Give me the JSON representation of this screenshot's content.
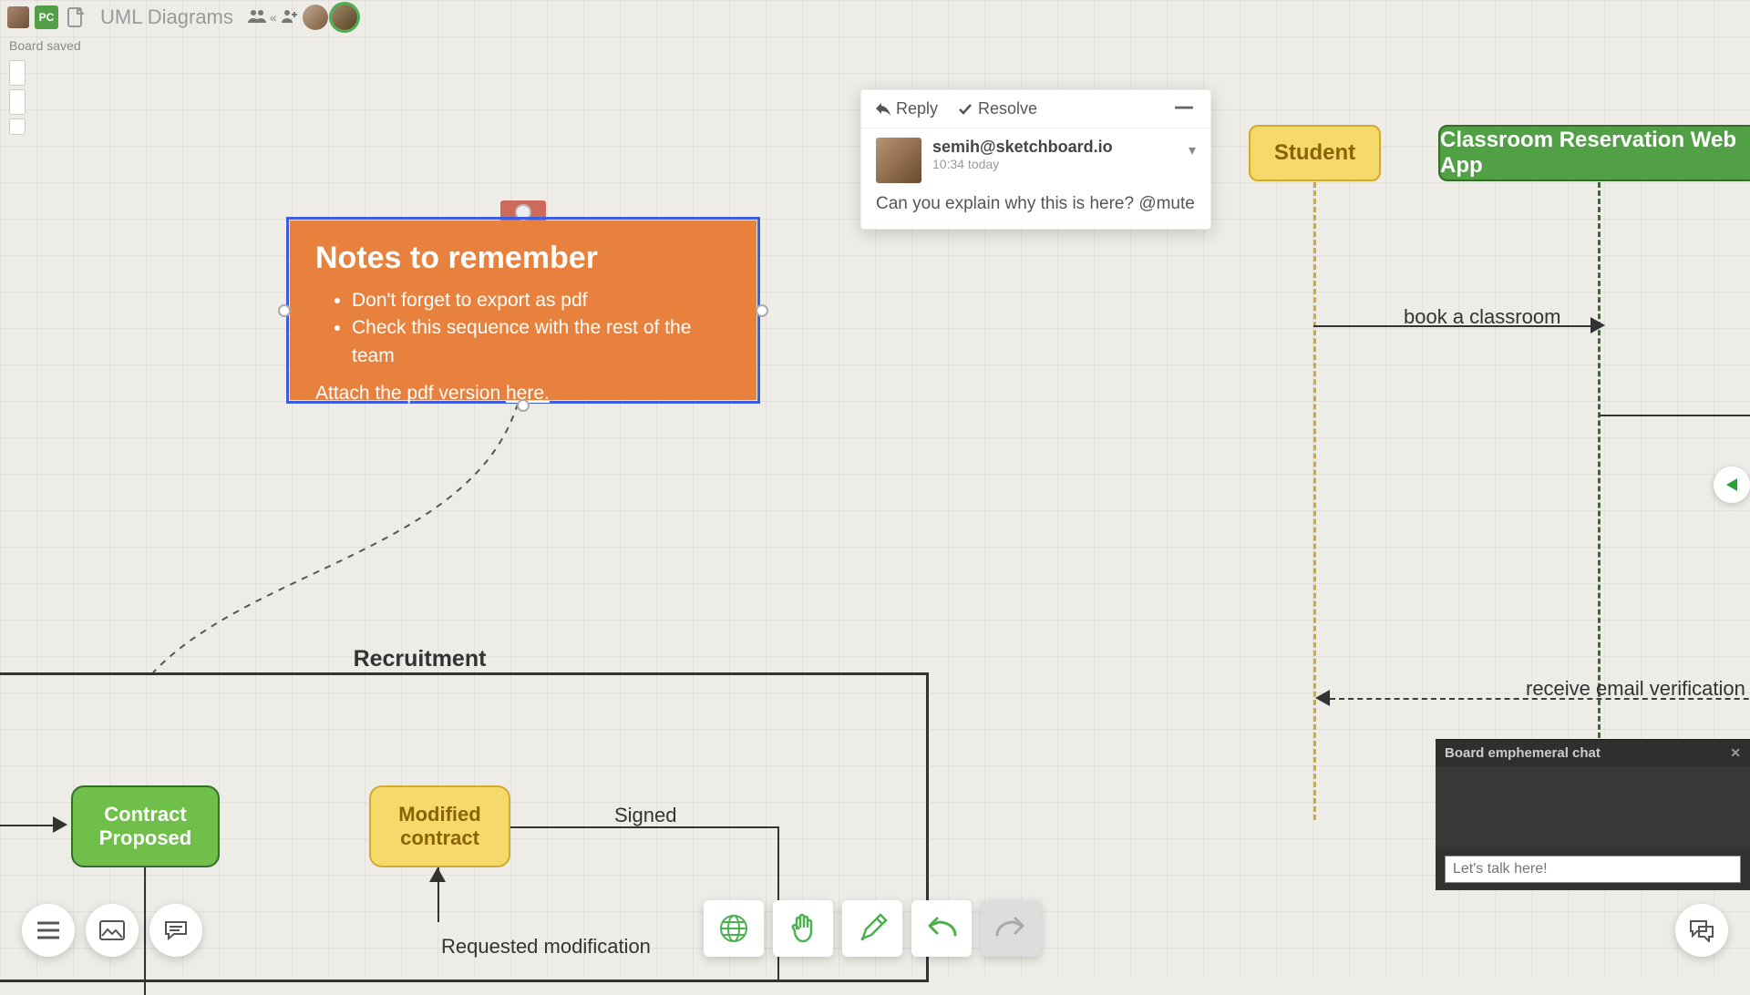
{
  "header": {
    "title": "UML Diagrams",
    "initials": "PC",
    "save_status": "Board saved"
  },
  "note": {
    "title": "Notes to remember",
    "bullets": [
      "Don't forget to export as pdf",
      "Check this sequence with the rest of the team"
    ],
    "footer_text": "Attach the pdf version ",
    "footer_link": "here."
  },
  "comment": {
    "reply": "Reply",
    "resolve": "Resolve",
    "user": "semih@sketchboard.io",
    "time": "10:34 today",
    "body": "Can you explain why this is here? @mute"
  },
  "sequence": {
    "actor1": "Student",
    "actor2": "Classroom Reservation Web App",
    "msg1": "book a classroom",
    "msg2": "receive email verification"
  },
  "recruitment": {
    "title": "Recruitment",
    "state1": "Contract Proposed",
    "state2": "Modified contract",
    "label_signed": "Signed",
    "label_requested": "Requested modification"
  },
  "chat": {
    "title": "Board emphemeral chat",
    "placeholder": "Let's talk here!"
  }
}
